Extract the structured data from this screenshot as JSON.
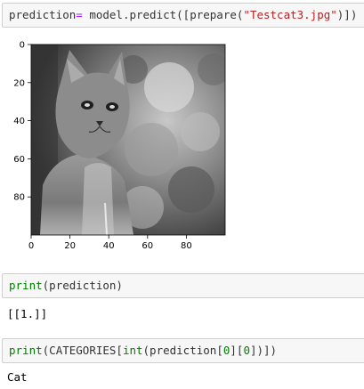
{
  "cells": {
    "c1": {
      "t1": "prediction",
      "t2": "=",
      "t3": " model.predict([prepare(",
      "t4": "\"Testcat3.jpg\"",
      "t5": ")])"
    },
    "c2": {
      "t1": "print",
      "t2": "(prediction)"
    },
    "c3": {
      "t1": "print",
      "t2": "(CATEGORIES[",
      "t3": "int",
      "t4": "(prediction[",
      "t5": "0",
      "t6": "][",
      "t7": "0",
      "t8": "])])"
    }
  },
  "outputs": {
    "prediction": "[[1.]]",
    "category": "Cat"
  },
  "plot": {
    "image_description_icon": "grayscale-cat-photo",
    "xticks": [
      "0",
      "20",
      "40",
      "60",
      "80"
    ],
    "yticks": [
      "0",
      "20",
      "40",
      "60",
      "80"
    ]
  },
  "colors": {
    "cell_bg": "#f7f7f7",
    "keyword": "#008000",
    "string": "#ba2121",
    "operator": "#aa22ff"
  }
}
